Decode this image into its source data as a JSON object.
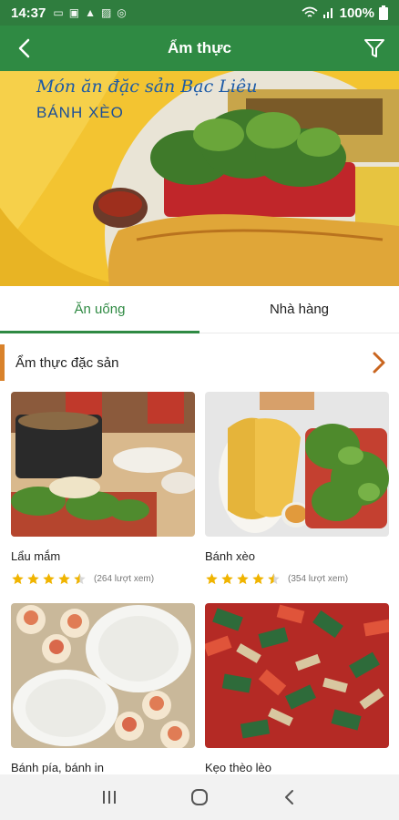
{
  "status_bar": {
    "time": "14:37",
    "battery": "100%"
  },
  "header": {
    "title": "Ẩm thực"
  },
  "banner": {
    "script_title": "Món ăn đặc sản Bạc Liêu",
    "dish_name": "BÁNH XÈO"
  },
  "tabs": [
    {
      "label": "Ăn uống",
      "active": true
    },
    {
      "label": "Nhà hàng",
      "active": false
    }
  ],
  "section": {
    "title": "Ẩm thực đặc sản"
  },
  "cards": [
    {
      "name": "Lẩu mắm",
      "rating": 4.5,
      "views": "(264 lượt xem)"
    },
    {
      "name": "Bánh xèo",
      "rating": 4.5,
      "views": "(354 lượt xem)"
    },
    {
      "name": "Bánh pía, bánh in",
      "rating": null,
      "views": ""
    },
    {
      "name": "Kẹo thèo lèo",
      "rating": null,
      "views": ""
    }
  ],
  "colors": {
    "primary": "#2f8a43",
    "status": "#2f7d3e",
    "accent": "#d9822b",
    "star": "#f0b400"
  },
  "icons": [
    "back-arrow-icon",
    "filter-icon",
    "chevron-right-icon",
    "recent-apps-icon",
    "home-icon",
    "back-icon"
  ]
}
